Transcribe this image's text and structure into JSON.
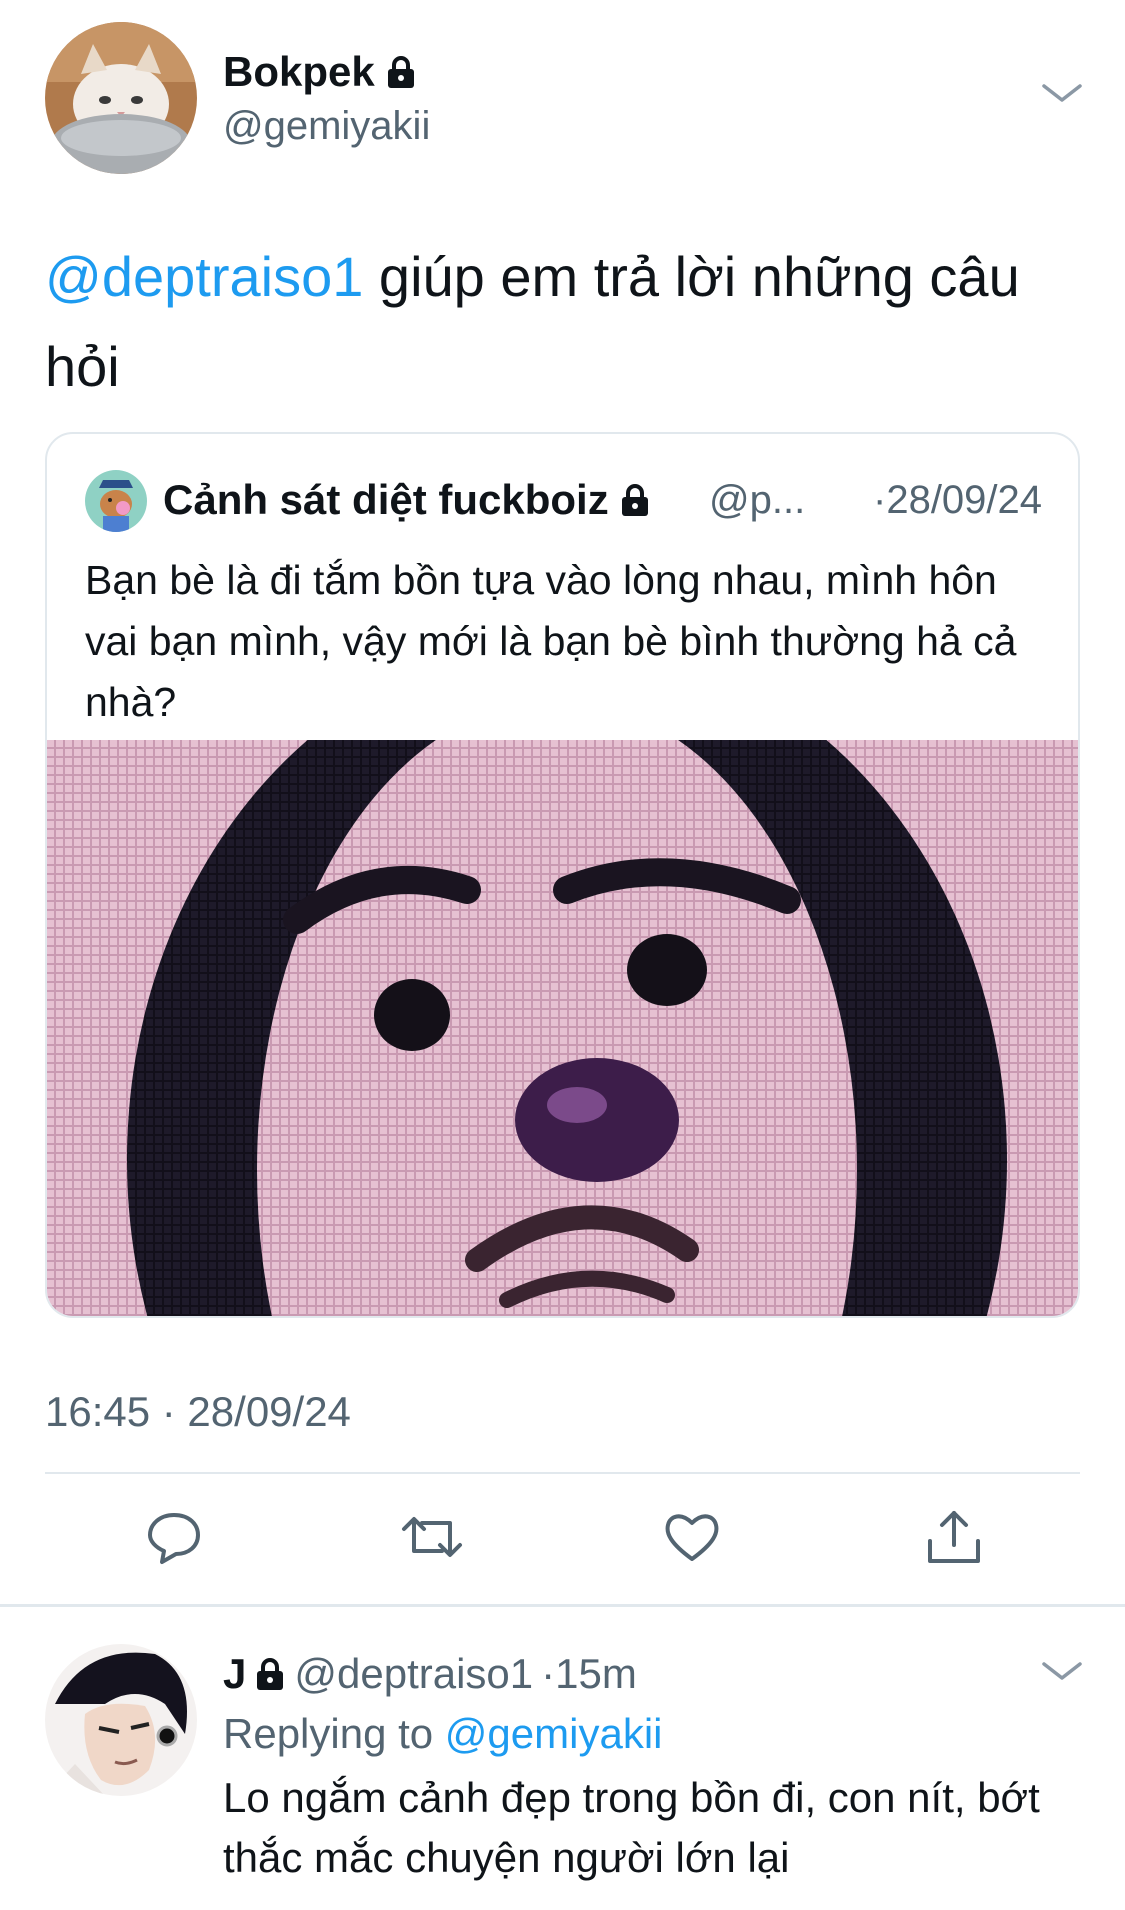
{
  "main_tweet": {
    "display_name": "Bokpek",
    "handle": "@gemiyakii",
    "text_mention": "@deptraiso1",
    "text_body": " giúp em trả lời những câu hỏi",
    "timestamp": "16:45 · 28/09/24"
  },
  "quoted_tweet": {
    "display_name": "Cảnh sát diệt fuckboiz",
    "handle": "@p...",
    "date": "·28/09/24",
    "text": "Bạn bè là đi tắm bồn tựa vào lòng nhau, mình hôn vai bạn mình, vậy mới là bạn bè bình thường hả cả nhà?"
  },
  "actions": [
    "reply-icon",
    "retweet-icon",
    "like-icon",
    "share-icon"
  ],
  "reply_tweet": {
    "display_name": "J",
    "handle": "@deptraiso1",
    "time": "·15m",
    "replying_prefix": "Replying to ",
    "replying_to": "@gemiyakii",
    "text": "Lo ngắm cảnh đẹp trong bồn đi, con nít, bớt thắc mắc chuyện người lớn lại"
  },
  "colors": {
    "accent": "#1d9bf0",
    "secondary_text": "#536471",
    "primary_text": "#0f1419",
    "divider": "#e1e8ed"
  }
}
